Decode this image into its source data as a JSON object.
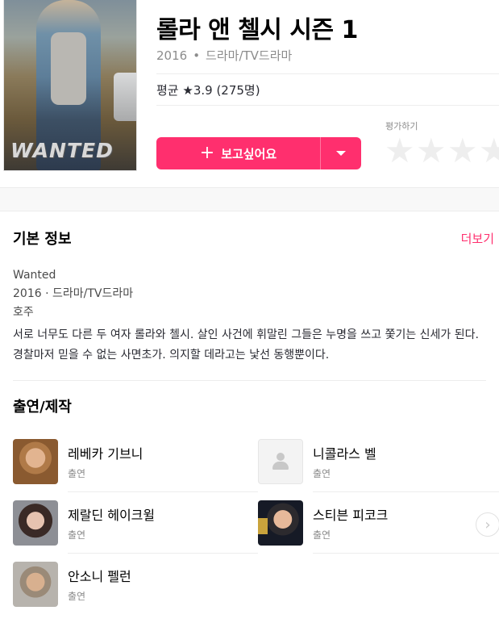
{
  "header": {
    "title": "롤라 앤 첼시 시즌 1",
    "year": "2016",
    "dot": "•",
    "genre": "드라마/TV드라마",
    "average": "평균 ★3.9 (275명)",
    "wish_label": "보고싶어요",
    "rate_label": "평가하기",
    "stars": [
      "★",
      "★",
      "★",
      "★"
    ],
    "poster_text": "WANTED"
  },
  "info": {
    "section_title": "기본 정보",
    "more_label": "더보기",
    "original_title": "Wanted",
    "year_genre": "2016 · 드라마/TV드라마",
    "country": "호주",
    "description": "서로 너무도 다른 두 여자 롤라와 첼시. 살인 사건에 휘말린 그들은 누명을 쓰고 쫓기는 신세가 된다. 경찰마저 믿을 수 없는 사면초가. 의지할 데라고는 낯선 동행뿐이다."
  },
  "cast": {
    "section_title": "출연/제작",
    "members": [
      {
        "name": "레베카 기브니",
        "role": "출연"
      },
      {
        "name": "니콜라스 벨",
        "role": "출연"
      },
      {
        "name": "제랄딘 헤이크윌",
        "role": "출연"
      },
      {
        "name": "스티븐 피코크",
        "role": "출연"
      },
      {
        "name": "안소니 펠런",
        "role": "출연"
      }
    ]
  },
  "colors": {
    "accent": "#ff2f6e",
    "text": "#292a32",
    "muted": "#8c8c8c"
  }
}
